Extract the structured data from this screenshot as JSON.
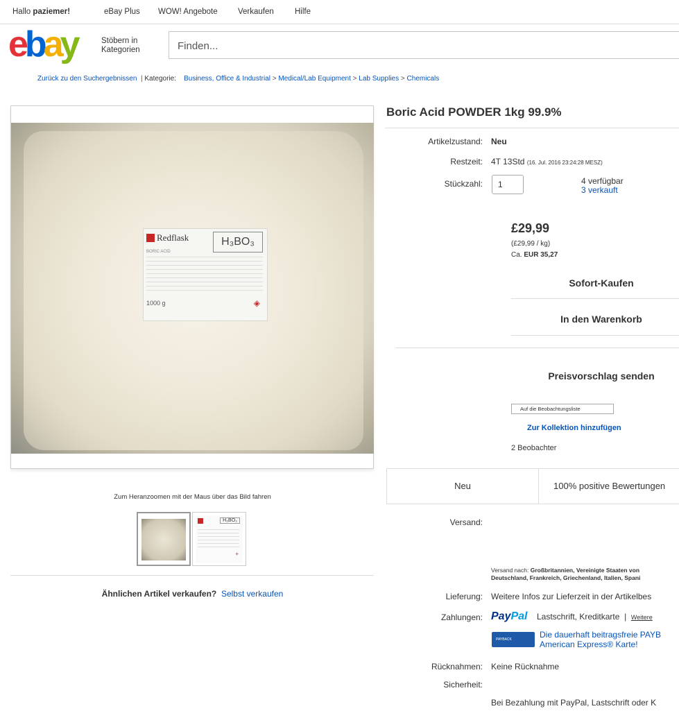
{
  "topbar": {
    "greeting_prefix": "Hallo",
    "username": "paziemer!",
    "links": [
      "eBay Plus",
      "WOW! Angebote",
      "Verkaufen",
      "Hilfe"
    ]
  },
  "header": {
    "logo_letters": [
      "e",
      "b",
      "a",
      "y"
    ],
    "browse_line1": "Stöbern in",
    "browse_line2": "Kategorien",
    "search_placeholder": "Finden..."
  },
  "breadcrumb": {
    "back": "Zurück zu den Suchergebnissen",
    "separator": "|",
    "category_label": "Kategorie:",
    "items": [
      "Business, Office & Industrial",
      "Medical/Lab Equipment",
      "Lab Supplies",
      "Chemicals"
    ],
    "arrow": ">"
  },
  "product_image": {
    "label_brand": "Redflask",
    "label_formula": "H₃BO₃",
    "label_name": "BORIC ACID",
    "label_weight": "1000 g"
  },
  "zoom_hint": "Zum Heranzoomen mit der Maus über das Bild fahren",
  "sell_similar": {
    "question": "Ähnlichen Artikel verkaufen?",
    "link": "Selbst verkaufen"
  },
  "listing": {
    "title": "Boric Acid POWDER 1kg 99.9%",
    "condition_label": "Artikelzustand:",
    "condition_value": "Neu",
    "time_label": "Restzeit:",
    "time_value": "4T 13Std",
    "time_detail": "(16. Jul. 2016  23:24:28 MESZ)",
    "qty_label": "Stückzahl:",
    "qty_value": "1",
    "available": "4 verfügbar",
    "sold": "3 verkauft",
    "price": "£29,99",
    "price_per_kg": "(£29,99 / kg)",
    "eur_prefix": "Ca.",
    "eur_value": "EUR 35,27",
    "buy_now": "Sofort-Kaufen",
    "add_to_cart": "In den Warenkorb",
    "make_offer": "Preisvorschlag senden",
    "watch": "Auf die Beobachtungsliste",
    "add_collection": "Zur Kollektion hinzufügen",
    "watchers": "2 Beobachter"
  },
  "seller_box": {
    "condition": "Neu",
    "feedback": "100% positive Bewertungen"
  },
  "details": {
    "shipping_label": "Versand:",
    "ship_to_prefix": "Versand nach:",
    "ship_to_line1": "Großbritannien, Vereinigte Staaten von",
    "ship_to_line2": "Deutschland, Frankreich, Griechenland, Italien, Spani",
    "delivery_label": "Lieferung:",
    "delivery_value": "Weitere Infos zur Lieferzeit in der Artikelbes",
    "payment_label": "Zahlungen:",
    "paypal_a": "Pay",
    "paypal_b": "Pal",
    "payment_methods": "Lastschrift, Kreditkarte",
    "payment_sep": "|",
    "payment_more": "Weitere",
    "payback_line1": "Die dauerhaft beitragsfreie PAYB",
    "payback_line2": "American Express® Karte!",
    "payback_icon_text": "PAYBACK",
    "returns_label": "Rücknahmen:",
    "returns_value": "Keine Rücknahme",
    "security_label": "Sicherheit:",
    "security_value": "Bei Bezahlung mit PayPal, Lastschrift oder K"
  }
}
